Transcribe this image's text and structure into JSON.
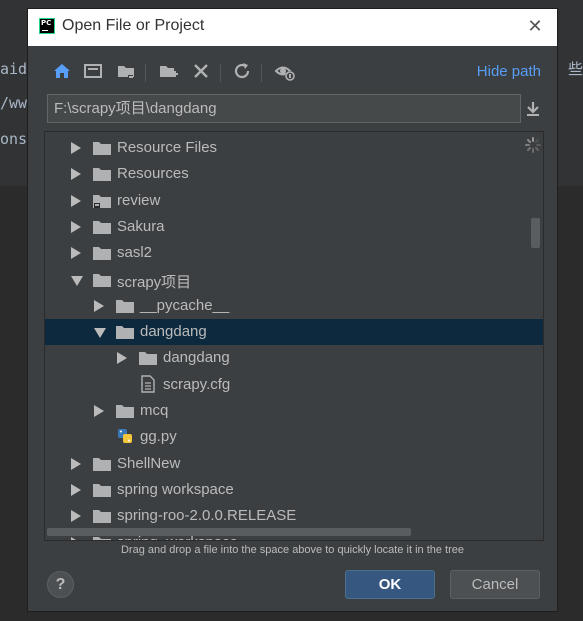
{
  "background": {
    "left_fragments": [
      "aid",
      "/ww",
      "ons"
    ],
    "right_fragment": "些"
  },
  "dialog": {
    "title": "Open File or Project",
    "app_icon_text": "PC"
  },
  "toolbar": {
    "icons": [
      "home-icon",
      "desktop-icon",
      "project-folder-icon",
      "new-folder-icon",
      "delete-icon",
      "refresh-icon",
      "show-hidden-icon"
    ],
    "hide_path_label": "Hide path"
  },
  "path_field": {
    "value": "F:\\scrapy项目\\dangdang"
  },
  "tree": {
    "rows": [
      {
        "label": "Resource Files",
        "arrow": "right",
        "type": "folder"
      },
      {
        "label": "Resources",
        "arrow": "right",
        "type": "folder"
      },
      {
        "label": "review",
        "arrow": "right",
        "type": "project-folder"
      },
      {
        "label": "Sakura",
        "arrow": "right",
        "type": "folder"
      },
      {
        "label": "sasl2",
        "arrow": "right",
        "type": "folder"
      },
      {
        "label": "scrapy项目",
        "arrow": "down",
        "type": "folder"
      },
      {
        "label": "__pycache__",
        "arrow": "right",
        "type": "folder"
      },
      {
        "label": "dangdang",
        "arrow": "down",
        "type": "folder",
        "selected": true
      },
      {
        "label": "dangdang",
        "arrow": "right",
        "type": "folder"
      },
      {
        "label": "scrapy.cfg",
        "arrow": "none",
        "type": "file"
      },
      {
        "label": "mcq",
        "arrow": "right",
        "type": "folder"
      },
      {
        "label": "gg.py",
        "arrow": "none",
        "type": "python"
      },
      {
        "label": "ShellNew",
        "arrow": "right",
        "type": "folder"
      },
      {
        "label": "spring workspace",
        "arrow": "right",
        "type": "folder"
      },
      {
        "label": "spring-roo-2.0.0.RELEASE",
        "arrow": "right",
        "type": "folder"
      },
      {
        "label": "spring_workspace",
        "arrow": "right",
        "type": "folder"
      }
    ]
  },
  "hint": "Drag and drop a file into the space above to quickly locate it in the tree",
  "buttons": {
    "help": "?",
    "ok": "OK",
    "cancel": "Cancel"
  },
  "colors": {
    "dialog_bg": "#3c3f41",
    "selection": "#0d293e",
    "link": "#589df6",
    "ok_bg": "#365880",
    "text": "#bbbbbb"
  }
}
